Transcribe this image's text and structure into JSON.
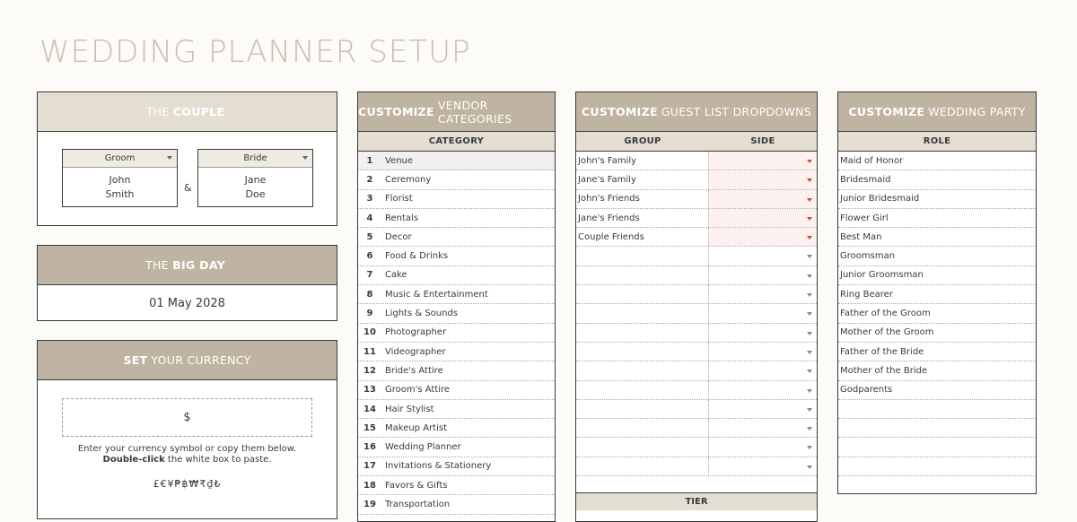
{
  "page": {
    "title": "WEDDING PLANNER SETUP"
  },
  "couple": {
    "head_light": "THE",
    "head_bold": "COUPLE",
    "groom_label": "Groom",
    "groom_name_1": "John",
    "groom_name_2": "Smith",
    "bride_label": "Bride",
    "bride_name_1": "Jane",
    "bride_name_2": "Doe",
    "amp": "&"
  },
  "bigday": {
    "head_light": "THE",
    "head_bold": "BIG DAY",
    "date": "01 May 2028"
  },
  "currency": {
    "head_bold": "SET",
    "head_light": "YOUR CURRENCY",
    "value": "$",
    "note_1": "Enter your currency symbol or copy them below.",
    "note_bold": "Double-click",
    "note_2": "the white box to paste.",
    "symbols": "£€¥₱฿₩₹₫₺"
  },
  "vendors": {
    "head_bold": "CUSTOMIZE",
    "head_light": "VENDOR CATEGORIES",
    "col": "CATEGORY",
    "rows": [
      {
        "num": "1",
        "label": "Venue"
      },
      {
        "num": "2",
        "label": "Ceremony"
      },
      {
        "num": "3",
        "label": "Florist"
      },
      {
        "num": "4",
        "label": "Rentals"
      },
      {
        "num": "5",
        "label": "Decor"
      },
      {
        "num": "6",
        "label": "Food & Drinks"
      },
      {
        "num": "7",
        "label": "Cake"
      },
      {
        "num": "8",
        "label": "Music & Entertainment"
      },
      {
        "num": "9",
        "label": "Lights & Sounds"
      },
      {
        "num": "10",
        "label": "Photographer"
      },
      {
        "num": "11",
        "label": "Videographer"
      },
      {
        "num": "12",
        "label": "Bride's Attire"
      },
      {
        "num": "13",
        "label": "Groom's Attire"
      },
      {
        "num": "14",
        "label": "Hair Stylist"
      },
      {
        "num": "15",
        "label": "Makeup Artist"
      },
      {
        "num": "16",
        "label": "Wedding Planner"
      },
      {
        "num": "17",
        "label": "Invitations & Stationery"
      },
      {
        "num": "18",
        "label": "Favors & Gifts"
      },
      {
        "num": "19",
        "label": "Transportation"
      }
    ]
  },
  "guests": {
    "head_bold": "CUSTOMIZE",
    "head_light": "GUEST LIST DROPDOWNS",
    "col_group": "GROUP",
    "col_side": "SIDE",
    "groups": [
      "John's Family",
      "Jane's Family",
      "John's Friends",
      "Jane's Friends",
      "Couple Friends",
      "",
      "",
      "",
      "",
      "",
      "",
      "",
      "",
      "",
      "",
      "",
      ""
    ],
    "tier_label": "TIER"
  },
  "party": {
    "head_bold": "CUSTOMIZE",
    "head_light": "WEDDING PARTY",
    "col": "ROLE",
    "roles": [
      "Maid of Honor",
      "Bridesmaid",
      "Junior Bridesmaid",
      "Flower Girl",
      "Best Man",
      "Groomsman",
      "Junior Groomsman",
      "Ring Bearer",
      "Father of the Groom",
      "Mother of the Groom",
      "Father of the Bride",
      "Mother of the Bride",
      "Godparents",
      "",
      "",
      "",
      "",
      ""
    ]
  },
  "colors": {
    "accent": "#bfb4a1",
    "accent_light": "#e4ded2",
    "alert_arrow": "#d9452b"
  }
}
